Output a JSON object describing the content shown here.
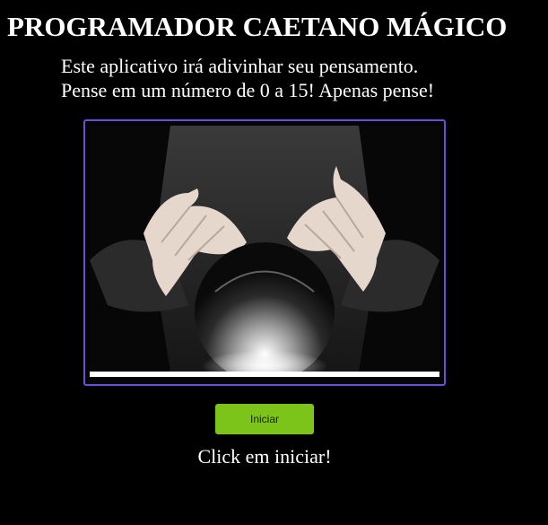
{
  "header": {
    "title": "PROGRAMADOR CAETANO MÁGICO"
  },
  "intro": {
    "line1": "Este aplicativo irá adivinhar seu pensamento.",
    "line2": "Pense em um número de 0 a 15! Apenas pense!"
  },
  "image": {
    "icon": "crystal-ball-hands-image",
    "progress_fraction": 1.0
  },
  "controls": {
    "start_label": "Iniciar"
  },
  "status": {
    "message": "Click em iniciar!"
  },
  "colors": {
    "background": "#000000",
    "text": "#ffffff",
    "frame_border": "#6c4fd8",
    "button": "#7cc419",
    "progress": "#ffffff"
  }
}
